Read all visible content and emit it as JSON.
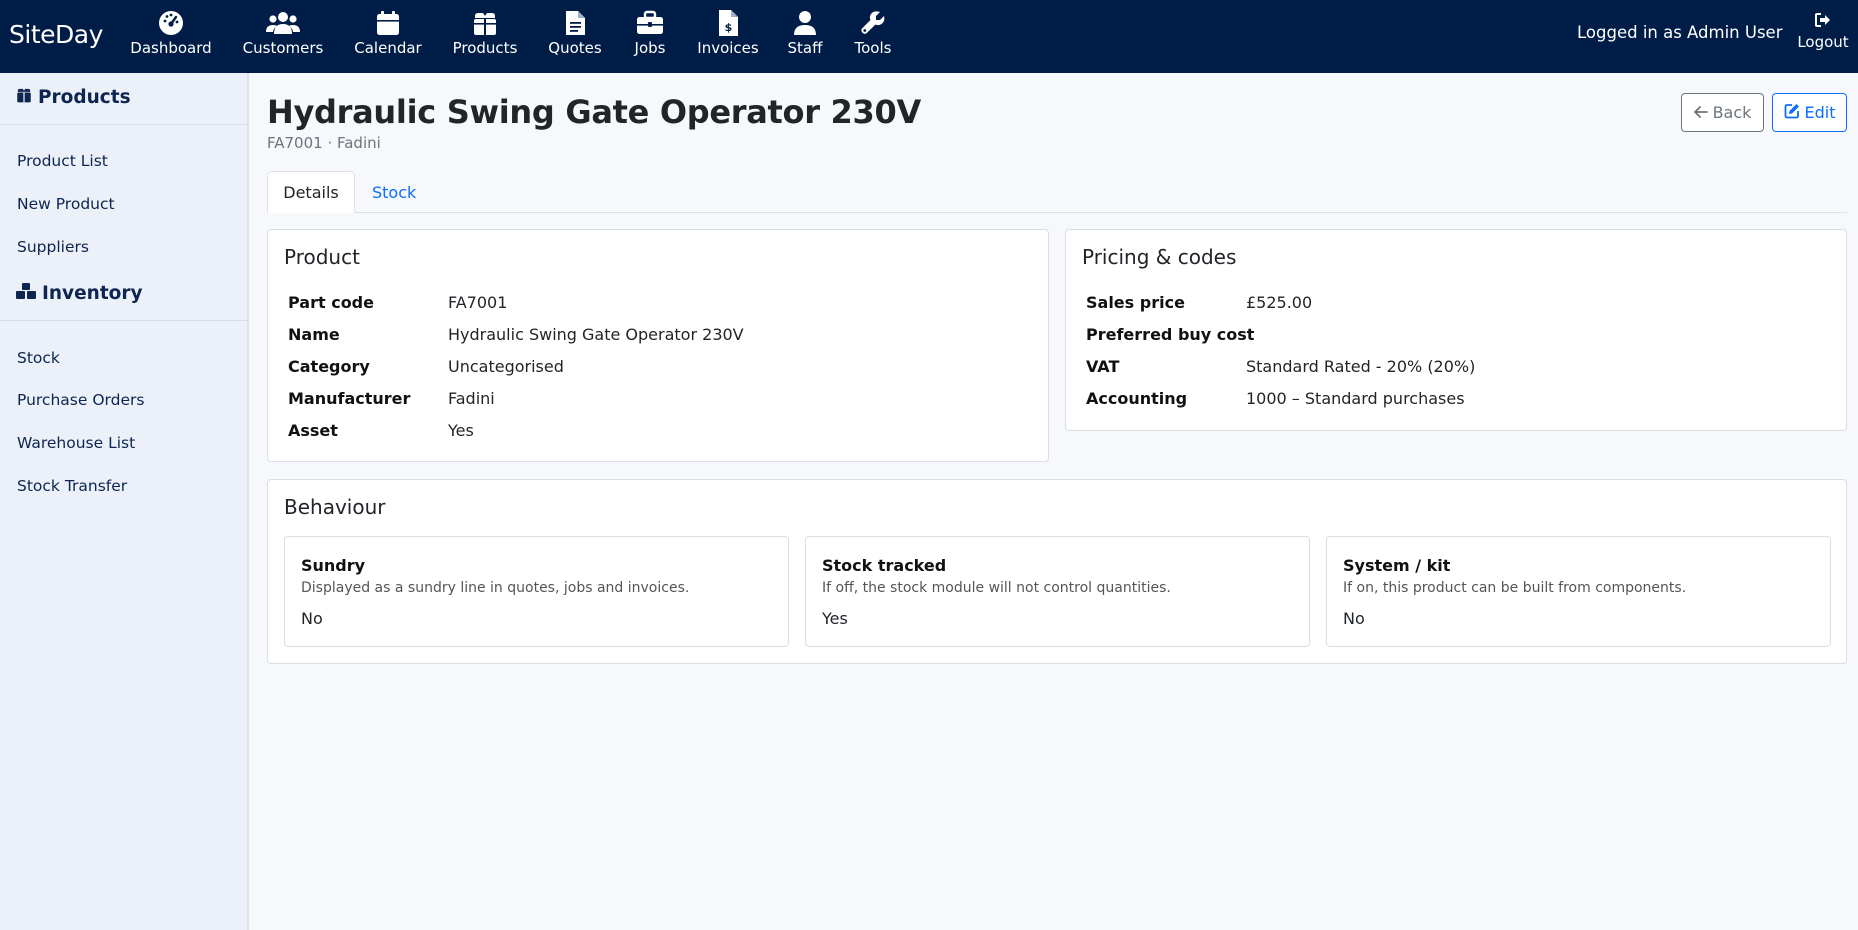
{
  "app": {
    "brand": "SiteDay"
  },
  "nav": {
    "items": [
      {
        "label": "Dashboard",
        "icon": "dashboard-icon"
      },
      {
        "label": "Customers",
        "icon": "users-icon"
      },
      {
        "label": "Calendar",
        "icon": "calendar-icon"
      },
      {
        "label": "Products",
        "icon": "gift-icon"
      },
      {
        "label": "Quotes",
        "icon": "file-icon"
      },
      {
        "label": "Jobs",
        "icon": "briefcase-icon"
      },
      {
        "label": "Invoices",
        "icon": "invoice-icon"
      },
      {
        "label": "Staff",
        "icon": "user-icon"
      },
      {
        "label": "Tools",
        "icon": "wrench-icon"
      }
    ],
    "user_text": "Logged in as Admin User",
    "logout_label": "Logout"
  },
  "sidebar": {
    "products_heading": "Products",
    "products_links": [
      "Product List",
      "New Product",
      "Suppliers"
    ],
    "inventory_heading": "Inventory",
    "inventory_links": [
      "Stock",
      "Purchase Orders",
      "Warehouse List",
      "Stock Transfer"
    ]
  },
  "page": {
    "title": "Hydraulic Swing Gate Operator 230V",
    "subtitle": "FA7001 · Fadini",
    "back_label": "Back",
    "edit_label": "Edit",
    "tabs": [
      {
        "label": "Details",
        "active": true
      },
      {
        "label": "Stock",
        "active": false
      }
    ]
  },
  "product_card": {
    "title": "Product",
    "rows": [
      {
        "label": "Part code",
        "value": "FA7001"
      },
      {
        "label": "Name",
        "value": "Hydraulic Swing Gate Operator 230V"
      },
      {
        "label": "Category",
        "value": "Uncategorised"
      },
      {
        "label": "Manufacturer",
        "value": "Fadini"
      },
      {
        "label": "Asset",
        "value": "Yes"
      }
    ]
  },
  "pricing_card": {
    "title": "Pricing & codes",
    "rows": [
      {
        "label": "Sales price",
        "value": "£525.00"
      },
      {
        "label": "Preferred buy cost",
        "value": ""
      },
      {
        "label": "VAT",
        "value": "Standard Rated - 20% (20%)"
      },
      {
        "label": "Accounting",
        "value": "1000 – Standard purchases"
      }
    ]
  },
  "behaviour_card": {
    "title": "Behaviour",
    "items": [
      {
        "heading": "Sundry",
        "description": "Displayed as a sundry line in quotes, jobs and invoices.",
        "value": "No"
      },
      {
        "heading": "Stock tracked",
        "description": "If off, the stock module will not control quantities.",
        "value": "Yes"
      },
      {
        "heading": "System / kit",
        "description": "If on, this product can be built from components.",
        "value": "No"
      }
    ]
  },
  "colors": {
    "navbar": "#001d48",
    "sidebar": "#ebf0f9",
    "accent": "#0d6efd",
    "secondary": "#6c757d"
  }
}
